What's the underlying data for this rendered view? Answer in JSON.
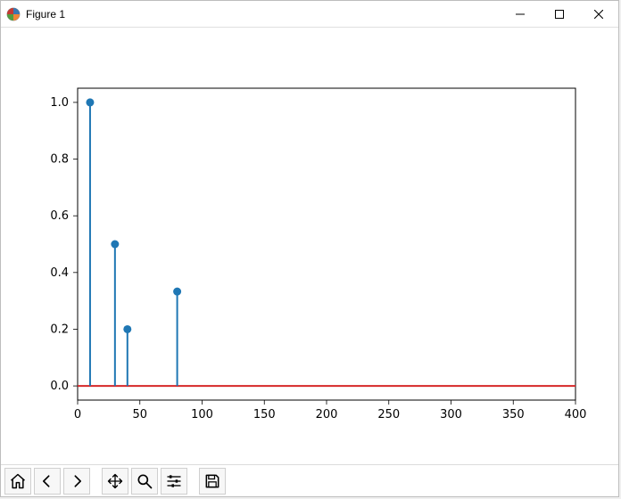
{
  "window": {
    "title": "Figure 1"
  },
  "chart_data": {
    "type": "stem",
    "title": "",
    "xlabel": "",
    "ylabel": "",
    "xlim": [
      0,
      400
    ],
    "ylim": [
      -0.05,
      1.05
    ],
    "xticks": [
      0,
      50,
      100,
      150,
      200,
      250,
      300,
      350,
      400
    ],
    "yticks": [
      0.0,
      0.2,
      0.4,
      0.6,
      0.8,
      1.0
    ],
    "baseline": 0.0,
    "stems": [
      {
        "x": 10,
        "y": 1.0
      },
      {
        "x": 30,
        "y": 0.5
      },
      {
        "x": 40,
        "y": 0.2
      },
      {
        "x": 80,
        "y": 0.333
      }
    ],
    "colors": {
      "stem": "#1f77b4",
      "marker": "#1f77b4",
      "baseline": "#d62728",
      "axes": "#000000"
    }
  },
  "toolbar": {
    "home": "Home",
    "back": "Back",
    "forward": "Forward",
    "pan": "Pan",
    "zoom": "Zoom",
    "subplots": "Configure subplots",
    "save": "Save"
  }
}
